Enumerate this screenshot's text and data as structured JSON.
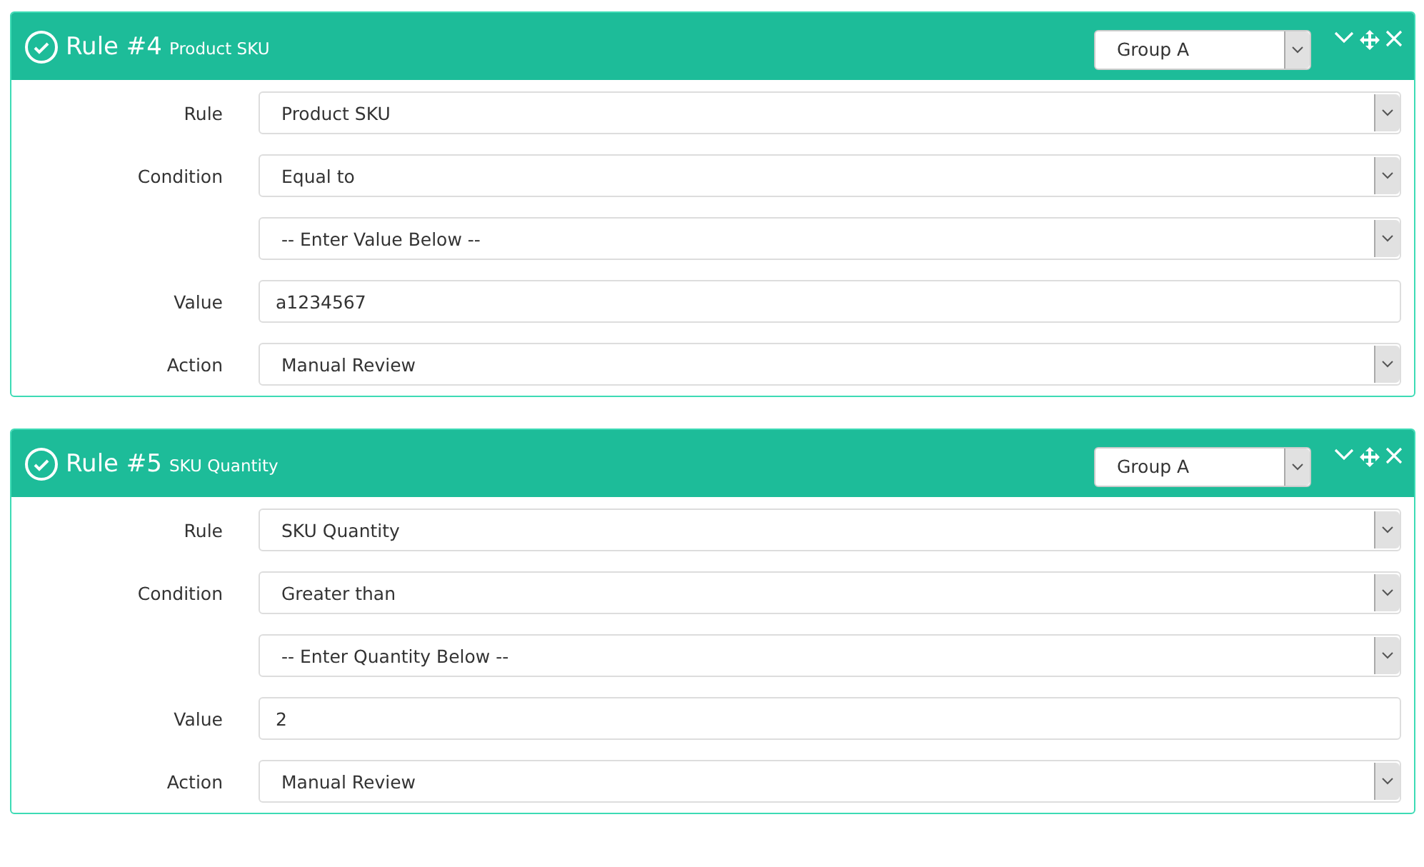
{
  "rules": [
    {
      "title": "Rule #4",
      "subtitle": "Product SKU",
      "group": "Group A",
      "fields": [
        {
          "label": "Rule",
          "kind": "select",
          "value": "Product SKU"
        },
        {
          "label": "Condition",
          "kind": "select",
          "value": "Equal to"
        },
        {
          "kind": "select",
          "value": "-- Enter Value Below --"
        },
        {
          "label": "Value",
          "kind": "input",
          "value": "a1234567"
        },
        {
          "label": "Action",
          "kind": "select",
          "value": "Manual Review"
        }
      ]
    },
    {
      "title": "Rule #5",
      "subtitle": "SKU Quantity",
      "group": "Group A",
      "fields": [
        {
          "label": "Rule",
          "kind": "select",
          "value": "SKU Quantity"
        },
        {
          "label": "Condition",
          "kind": "select",
          "value": "Greater than"
        },
        {
          "kind": "select",
          "value": "-- Enter Quantity Below --"
        },
        {
          "label": "Value",
          "kind": "input",
          "value": "2"
        },
        {
          "label": "Action",
          "kind": "select",
          "value": "Manual Review"
        }
      ]
    }
  ]
}
